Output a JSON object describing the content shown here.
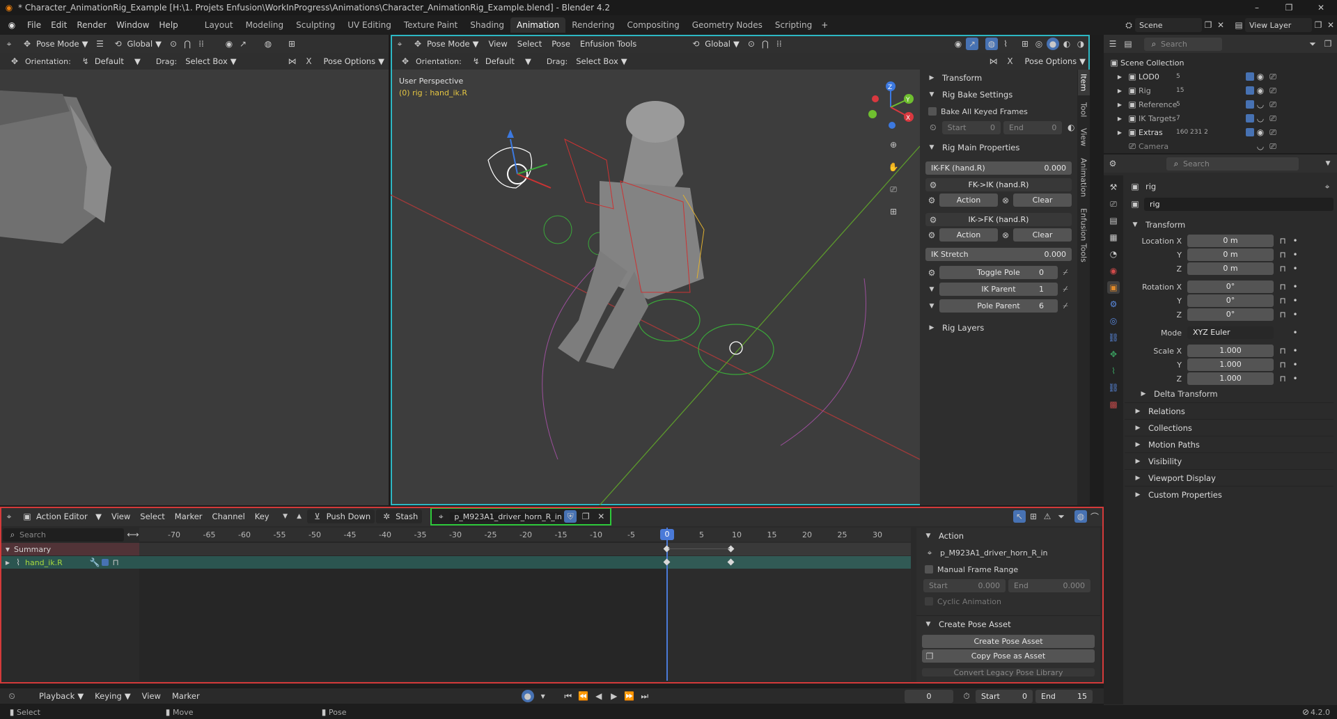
{
  "title": "* Character_AnimationRig_Example [H:\\1. Projets Enfusion\\WorkInProgress\\Animations\\Character_AnimationRig_Example.blend] - Blender 4.2",
  "menu": [
    "File",
    "Edit",
    "Render",
    "Window",
    "Help"
  ],
  "workspaces": [
    "Layout",
    "Modeling",
    "Sculpting",
    "UV Editing",
    "Texture Paint",
    "Shading",
    "Animation",
    "Rendering",
    "Compositing",
    "Geometry Nodes",
    "Scripting"
  ],
  "scene": "Scene",
  "view_layer": "View Layer",
  "left_vp": {
    "mode": "Pose Mode",
    "transform": "Global",
    "orientation_label": "Orientation:",
    "orientation": "Default",
    "drag_label": "Drag:",
    "drag": "Select Box",
    "pose_options": "Pose Options"
  },
  "main_vp": {
    "mode": "Pose Mode",
    "menus": [
      "View",
      "Select",
      "Pose",
      "Enfusion Tools"
    ],
    "transform": "Global",
    "orientation_label": "Orientation:",
    "orientation": "Default",
    "drag_label": "Drag:",
    "drag": "Select Box",
    "pose_options": "Pose Options",
    "overlay1": "User Perspective",
    "overlay2": "(0) rig : hand_ik.R"
  },
  "npanel": {
    "tabs": [
      "Item",
      "Tool",
      "View",
      "Animation",
      "Enfusion Tools"
    ],
    "transform": "Transform",
    "rig_bake": "Rig Bake Settings",
    "bake_all": "Bake All Keyed Frames",
    "start_label": "Start",
    "start_val": "0",
    "end_label": "End",
    "end_val": "0",
    "rig_main": "Rig Main Properties",
    "ikfk_label": "IK-FK (hand.R)",
    "ikfk_val": "0.000",
    "fk_ik": "FK->IK (hand.R)",
    "ik_fk": "IK->FK (hand.R)",
    "action": "Action",
    "clear": "Clear",
    "ik_stretch_label": "IK Stretch",
    "ik_stretch_val": "0.000",
    "toggle_pole_label": "Toggle Pole",
    "toggle_pole_val": "0",
    "ik_parent_label": "IK Parent",
    "ik_parent_val": "1",
    "pole_parent_label": "Pole Parent",
    "pole_parent_val": "6",
    "rig_layers": "Rig Layers"
  },
  "outliner": {
    "search": "Search",
    "root": "Scene Collection",
    "items": [
      {
        "name": "LOD0",
        "badge": "5"
      },
      {
        "name": "Rig",
        "badge": "15"
      },
      {
        "name": "Reference",
        "badge": "5"
      },
      {
        "name": "IK Targets",
        "badge": "7"
      },
      {
        "name": "Extras",
        "badge": "160 231 2"
      },
      {
        "name": "Camera",
        "badge": ""
      }
    ]
  },
  "props": {
    "search": "Search",
    "object": "rig",
    "datablock": "rig",
    "transform": "Transform",
    "rows": [
      {
        "label": "Location X",
        "value": "0 m"
      },
      {
        "label": "Y",
        "value": "0 m"
      },
      {
        "label": "Z",
        "value": "0 m"
      },
      {
        "label": "Rotation X",
        "value": "0°"
      },
      {
        "label": "Y",
        "value": "0°"
      },
      {
        "label": "Z",
        "value": "0°"
      },
      {
        "label": "Mode",
        "value": "XYZ Euler"
      },
      {
        "label": "Scale X",
        "value": "1.000"
      },
      {
        "label": "Y",
        "value": "1.000"
      },
      {
        "label": "Z",
        "value": "1.000"
      }
    ],
    "delta": "Delta Transform",
    "sections": [
      "Relations",
      "Collections",
      "Motion Paths",
      "Visibility",
      "Viewport Display",
      "Custom Properties"
    ]
  },
  "action_editor": {
    "mode": "Action Editor",
    "menus": [
      "View",
      "Select",
      "Marker",
      "Channel",
      "Key"
    ],
    "push_down": "Push Down",
    "stash": "Stash",
    "action": "p_M923A1_driver_horn_R_in",
    "search": "Search",
    "summary": "Summary",
    "channel": "hand_ik.R",
    "ticks": [
      "-70",
      "-65",
      "-60",
      "-55",
      "-50",
      "-45",
      "-40",
      "-35",
      "-30",
      "-25",
      "-20",
      "-15",
      "-10",
      "-5",
      "0",
      "5",
      "10",
      "15",
      "20",
      "25",
      "30"
    ],
    "current_frame": "0"
  },
  "action_panel": {
    "action_hdr": "Action",
    "action_name": "p_M923A1_driver_horn_R_in",
    "manual_range": "Manual Frame Range",
    "start_label": "Start",
    "start_val": "0.000",
    "end_label": "End",
    "end_val": "0.000",
    "cyclic": "Cyclic Animation",
    "create_pose_hdr": "Create Pose Asset",
    "create_pose": "Create Pose Asset",
    "copy_pose": "Copy Pose as Asset",
    "convert": "Convert Legacy Pose Library"
  },
  "timeline": {
    "menus": [
      "Playback",
      "Keying",
      "View",
      "Marker"
    ],
    "frame": "0",
    "start_label": "Start",
    "start": "0",
    "end_label": "End",
    "end": "15"
  },
  "status": {
    "select": "Select",
    "move": "Move",
    "pose": "Pose",
    "version": "4.2.0"
  }
}
